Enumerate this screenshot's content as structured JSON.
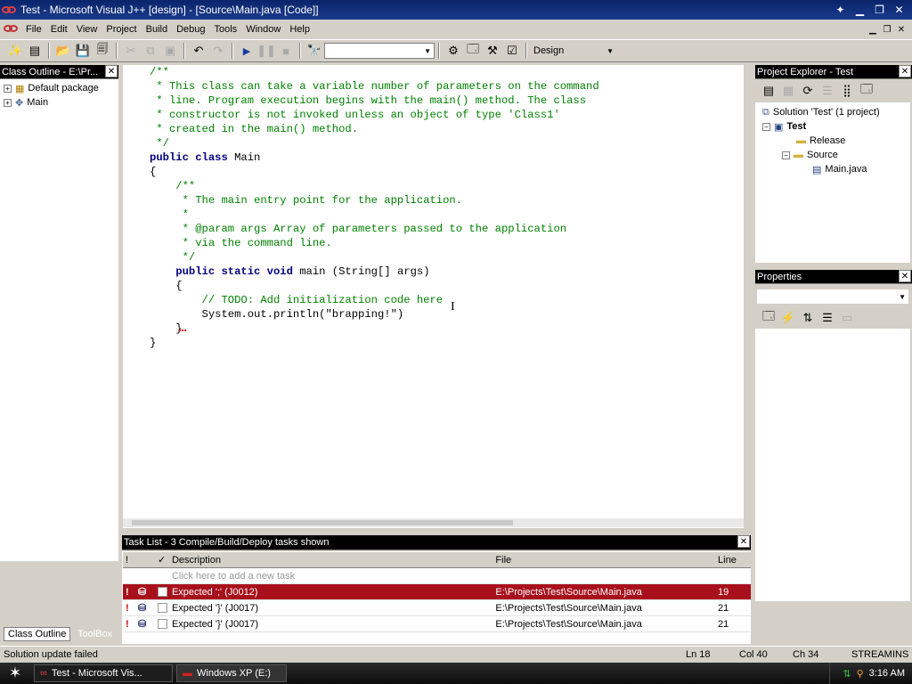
{
  "window": {
    "title": "Test - Microsoft Visual J++ [design] - [Source\\Main.java [Code]]"
  },
  "menu": [
    "File",
    "Edit",
    "View",
    "Project",
    "Build",
    "Debug",
    "Tools",
    "Window",
    "Help"
  ],
  "toolbar": {
    "find_combo": "",
    "config_combo": "Design"
  },
  "class_outline": {
    "title": "Class Outline - E:\\Pr...",
    "items": [
      "Default package",
      "Main"
    ]
  },
  "left_tabs": [
    "Class Outline",
    "ToolBox"
  ],
  "code_lines": [
    [
      {
        "t": "/**",
        "c": "cm"
      }
    ],
    [
      {
        "t": " * This class can take a variable number of parameters on the command",
        "c": "cm"
      }
    ],
    [
      {
        "t": " * line. Program execution begins with the main() method. The class",
        "c": "cm"
      }
    ],
    [
      {
        "t": " * constructor is not invoked unless an object of type 'Class1'",
        "c": "cm"
      }
    ],
    [
      {
        "t": " * created in the main() method.",
        "c": "cm"
      }
    ],
    [
      {
        "t": " */",
        "c": "cm"
      }
    ],
    [
      {
        "t": "public class",
        "c": "kw"
      },
      {
        "t": " Main",
        "c": "tx"
      }
    ],
    [
      {
        "t": "{",
        "c": "tx"
      }
    ],
    [
      {
        "t": "    /**",
        "c": "cm"
      }
    ],
    [
      {
        "t": "     * The main entry point for the application.",
        "c": "cm"
      }
    ],
    [
      {
        "t": "     *",
        "c": "cm"
      }
    ],
    [
      {
        "t": "     * @param args Array of parameters passed to the application",
        "c": "cm"
      }
    ],
    [
      {
        "t": "     * via the command line.",
        "c": "cm"
      }
    ],
    [
      {
        "t": "     */",
        "c": "cm"
      }
    ],
    [
      {
        "t": "    ",
        "c": "tx"
      },
      {
        "t": "public static void",
        "c": "kw"
      },
      {
        "t": " main (String[] args)",
        "c": "tx"
      }
    ],
    [
      {
        "t": "    {",
        "c": "tx"
      }
    ],
    [
      {
        "t": "        // TODO: Add initialization code here",
        "c": "cm"
      }
    ],
    [
      {
        "t": "        System.out.println(\"brapping!\")",
        "c": "tx"
      }
    ],
    [
      {
        "t": "    }",
        "c": "tx"
      }
    ],
    [
      {
        "t": "}",
        "c": "tx"
      }
    ],
    [
      {
        "t": "",
        "c": "tx"
      }
    ]
  ],
  "project_explorer": {
    "title": "Project Explorer - Test",
    "solution": "Solution 'Test' (1 project)",
    "project": "Test",
    "folders": [
      "Release",
      "Source"
    ],
    "file": "Main.java"
  },
  "properties": {
    "title": "Properties"
  },
  "task_list": {
    "title": "Task List - 3 Compile/Build/Deploy tasks shown",
    "headers": [
      "!",
      "",
      "✓",
      "Description",
      "File",
      "Line"
    ],
    "add_hint": "Click here to add a new task",
    "rows": [
      {
        "description": "Expected ';' (J0012)",
        "file": "E:\\Projects\\Test\\Source\\Main.java",
        "line": "19",
        "selected": true
      },
      {
        "description": "Expected '}' (J0017)",
        "file": "E:\\Projects\\Test\\Source\\Main.java",
        "line": "21",
        "selected": false
      },
      {
        "description": "Expected '}' (J0017)",
        "file": "E:\\Projects\\Test\\Source\\Main.java",
        "line": "21",
        "selected": false
      }
    ]
  },
  "status": {
    "message": "Solution update failed",
    "ln": "Ln 18",
    "col": "Col 40",
    "ch": "Ch 34",
    "mode1": "STREAM",
    "mode2": "INS"
  },
  "taskbar": {
    "apps": [
      "Test - Microsoft Vis...",
      "Windows XP (E:)"
    ],
    "clock": "3:16 AM"
  }
}
